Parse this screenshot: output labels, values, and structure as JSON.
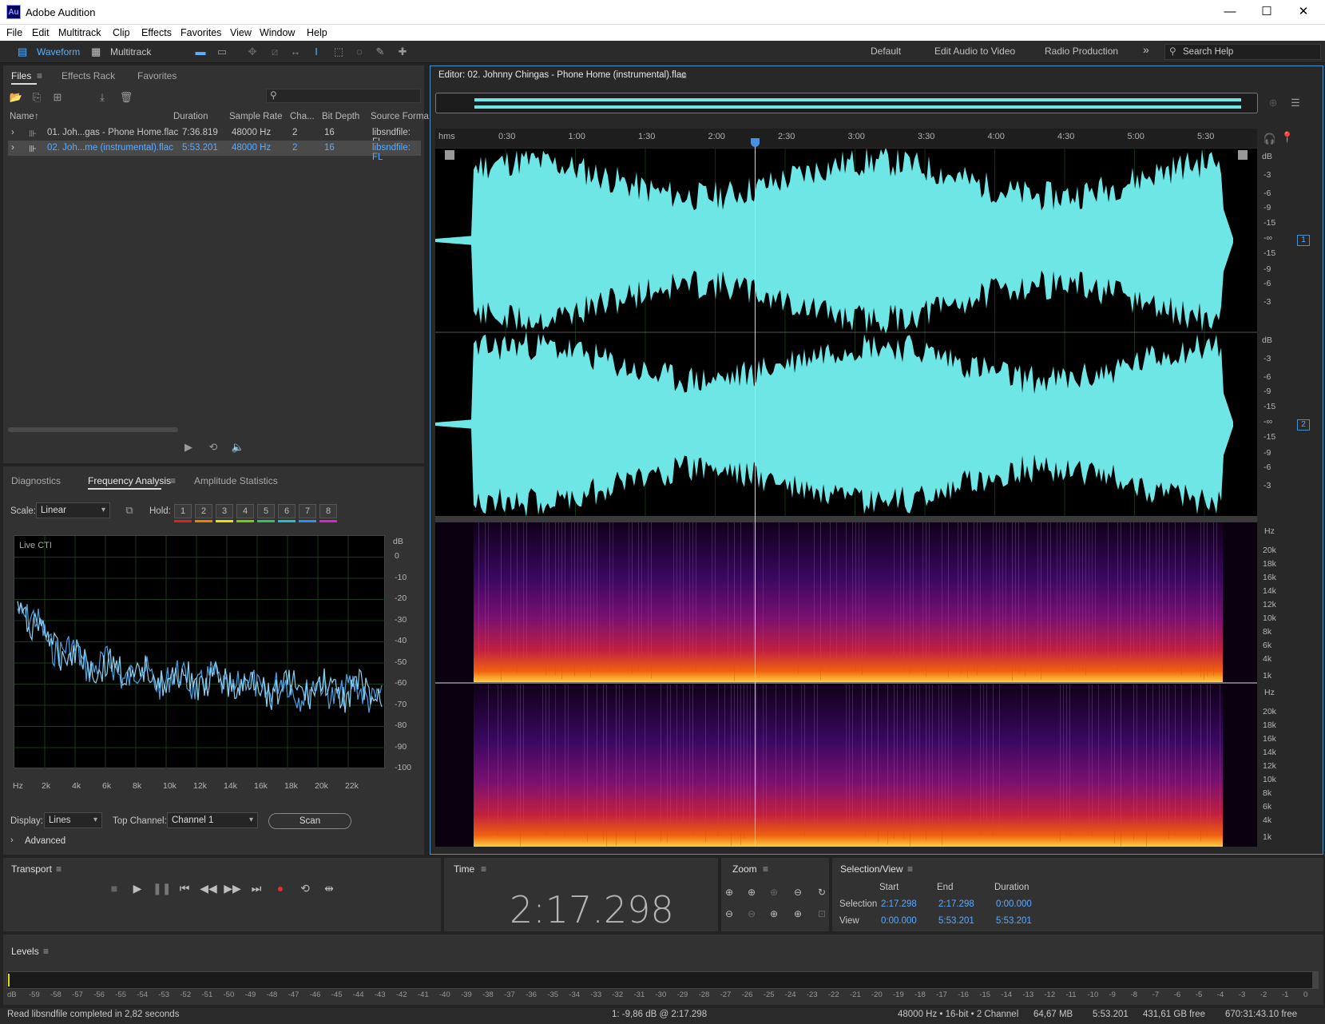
{
  "app": {
    "title": "Adobe Audition",
    "logo": "Au"
  },
  "window": {
    "min": "—",
    "max": "☐",
    "close": "✕"
  },
  "menu": [
    "File",
    "Edit",
    "Multitrack",
    "Clip",
    "Effects",
    "Favorites",
    "View",
    "Window",
    "Help"
  ],
  "toolbar": {
    "waveform": "Waveform",
    "multitrack": "Multitrack",
    "workspaces": [
      "Default",
      "Edit Audio to Video",
      "Radio Production"
    ],
    "more": "»",
    "search_placeholder": "Search Help"
  },
  "files_panel": {
    "tabs": [
      "Files",
      "Effects Rack",
      "Favorites"
    ],
    "columns": [
      "Name",
      "Duration",
      "Sample Rate",
      "Cha...",
      "Bit Depth",
      "Source Forma"
    ],
    "rows": [
      {
        "name": "01. Joh...gas - Phone Home.flac",
        "duration": "7:36.819",
        "rate": "48000 Hz",
        "ch": "2",
        "bits": "16",
        "fmt": "libsndfile: FL"
      },
      {
        "name": "02. Joh...me (instrumental).flac",
        "duration": "5:53.201",
        "rate": "48000 Hz",
        "ch": "2",
        "bits": "16",
        "fmt": "libsndfile: FL"
      }
    ]
  },
  "analysis_panel": {
    "tabs": [
      "Diagnostics",
      "Frequency Analysis",
      "Amplitude Statistics"
    ],
    "scale_label": "Scale:",
    "scale_value": "Linear",
    "hold_label": "Hold:",
    "hold": [
      "1",
      "2",
      "3",
      "4",
      "5",
      "6",
      "7",
      "8"
    ],
    "hold_colors": [
      "#e02020",
      "#f08000",
      "#e8e000",
      "#70d000",
      "#30c060",
      "#20c0d0",
      "#3090f0",
      "#e020d0"
    ],
    "live": "Live CTI",
    "db_ticks": [
      "dB",
      "0",
      "-10",
      "-20",
      "-30",
      "-40",
      "-50",
      "-60",
      "-70",
      "-80",
      "-90",
      "-100"
    ],
    "hz_ticks": [
      "Hz",
      "2k",
      "4k",
      "6k",
      "8k",
      "10k",
      "12k",
      "14k",
      "16k",
      "18k",
      "20k",
      "22k"
    ],
    "display_label": "Display:",
    "display_value": "Lines",
    "top_channel_label": "Top Channel:",
    "top_channel_value": "Channel 1",
    "scan": "Scan",
    "advanced": "Advanced"
  },
  "editor": {
    "title": "Editor: 02. Johnny Chingas - Phone Home (instrumental).flac",
    "ruler": [
      "hms",
      "0:30",
      "1:00",
      "1:30",
      "2:00",
      "2:30",
      "3:00",
      "3:30",
      "4:00",
      "4:30",
      "5:00",
      "5:30"
    ],
    "db_scale": [
      "dB",
      "-3",
      "-6",
      "-9",
      "-15",
      "-∞",
      "-15",
      "-9",
      "-6",
      "-3"
    ],
    "hz_scale": [
      "Hz",
      "20k",
      "18k",
      "16k",
      "14k",
      "12k",
      "10k",
      "8k",
      "6k",
      "4k",
      "1k"
    ],
    "channels": [
      "1",
      "2"
    ],
    "colors": {
      "waveform": "#6ee6e6",
      "playhead": "#f0e040",
      "border": "#4a90c8"
    }
  },
  "transport": {
    "title": "Transport"
  },
  "time": {
    "title": "Time",
    "value": "2:17.298"
  },
  "zoom": {
    "title": "Zoom"
  },
  "selection": {
    "title": "Selection/View",
    "headers": [
      "Start",
      "End",
      "Duration"
    ],
    "rows": [
      {
        "label": "Selection",
        "start": "2:17.298",
        "end": "2:17.298",
        "duration": "0:00.000"
      },
      {
        "label": "View",
        "start": "0:00.000",
        "end": "5:53.201",
        "duration": "5:53.201"
      }
    ]
  },
  "levels": {
    "title": "Levels",
    "scale": [
      "dB",
      "-59",
      "-58",
      "-57",
      "-56",
      "-55",
      "-54",
      "-53",
      "-52",
      "-51",
      "-50",
      "-49",
      "-48",
      "-47",
      "-46",
      "-45",
      "-44",
      "-43",
      "-42",
      "-41",
      "-40",
      "-39",
      "-38",
      "-37",
      "-36",
      "-35",
      "-34",
      "-33",
      "-32",
      "-31",
      "-30",
      "-29",
      "-28",
      "-27",
      "-26",
      "-25",
      "-24",
      "-23",
      "-22",
      "-21",
      "-20",
      "-19",
      "-18",
      "-17",
      "-16",
      "-15",
      "-14",
      "-13",
      "-12",
      "-11",
      "-10",
      "-9",
      "-8",
      "-7",
      "-6",
      "-5",
      "-4",
      "-3",
      "-2",
      "-1",
      "0"
    ]
  },
  "status": {
    "left": "Read libsndfile completed in 2,82 seconds",
    "cursor": "1: -9,86 dB @ 2:17.298",
    "format": "48000 Hz • 16-bit • 2 Channel",
    "size": "64,67 MB",
    "duration": "5:53.201",
    "free": "431,61 GB free",
    "free_time": "670:31:43.10 free"
  }
}
